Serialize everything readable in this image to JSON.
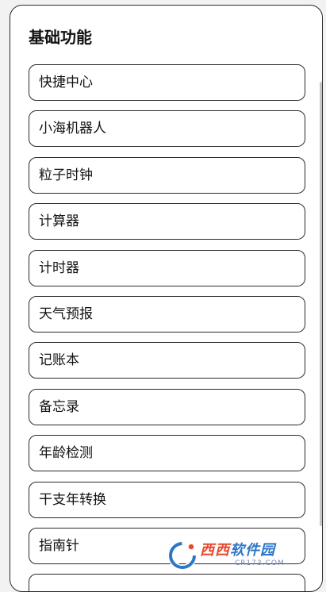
{
  "section": {
    "title": "基础功能"
  },
  "items": [
    {
      "label": "快捷中心"
    },
    {
      "label": "小海机器人"
    },
    {
      "label": "粒子时钟"
    },
    {
      "label": "计算器"
    },
    {
      "label": "计时器"
    },
    {
      "label": "天气预报"
    },
    {
      "label": "记账本"
    },
    {
      "label": "备忘录"
    },
    {
      "label": "年龄检测"
    },
    {
      "label": "干支年转换"
    },
    {
      "label": "指南针"
    },
    {
      "label": ""
    }
  ],
  "watermark": {
    "brand_accent": "西西",
    "brand_rest": "软件园",
    "domain": "CR173.COM"
  },
  "colors": {
    "background": "#f2f2f2",
    "card": "#ffffff",
    "border": "#2a2a2a",
    "text": "#111111",
    "watermark_blue": "#2e77c8",
    "watermark_red": "#e64a2e"
  }
}
